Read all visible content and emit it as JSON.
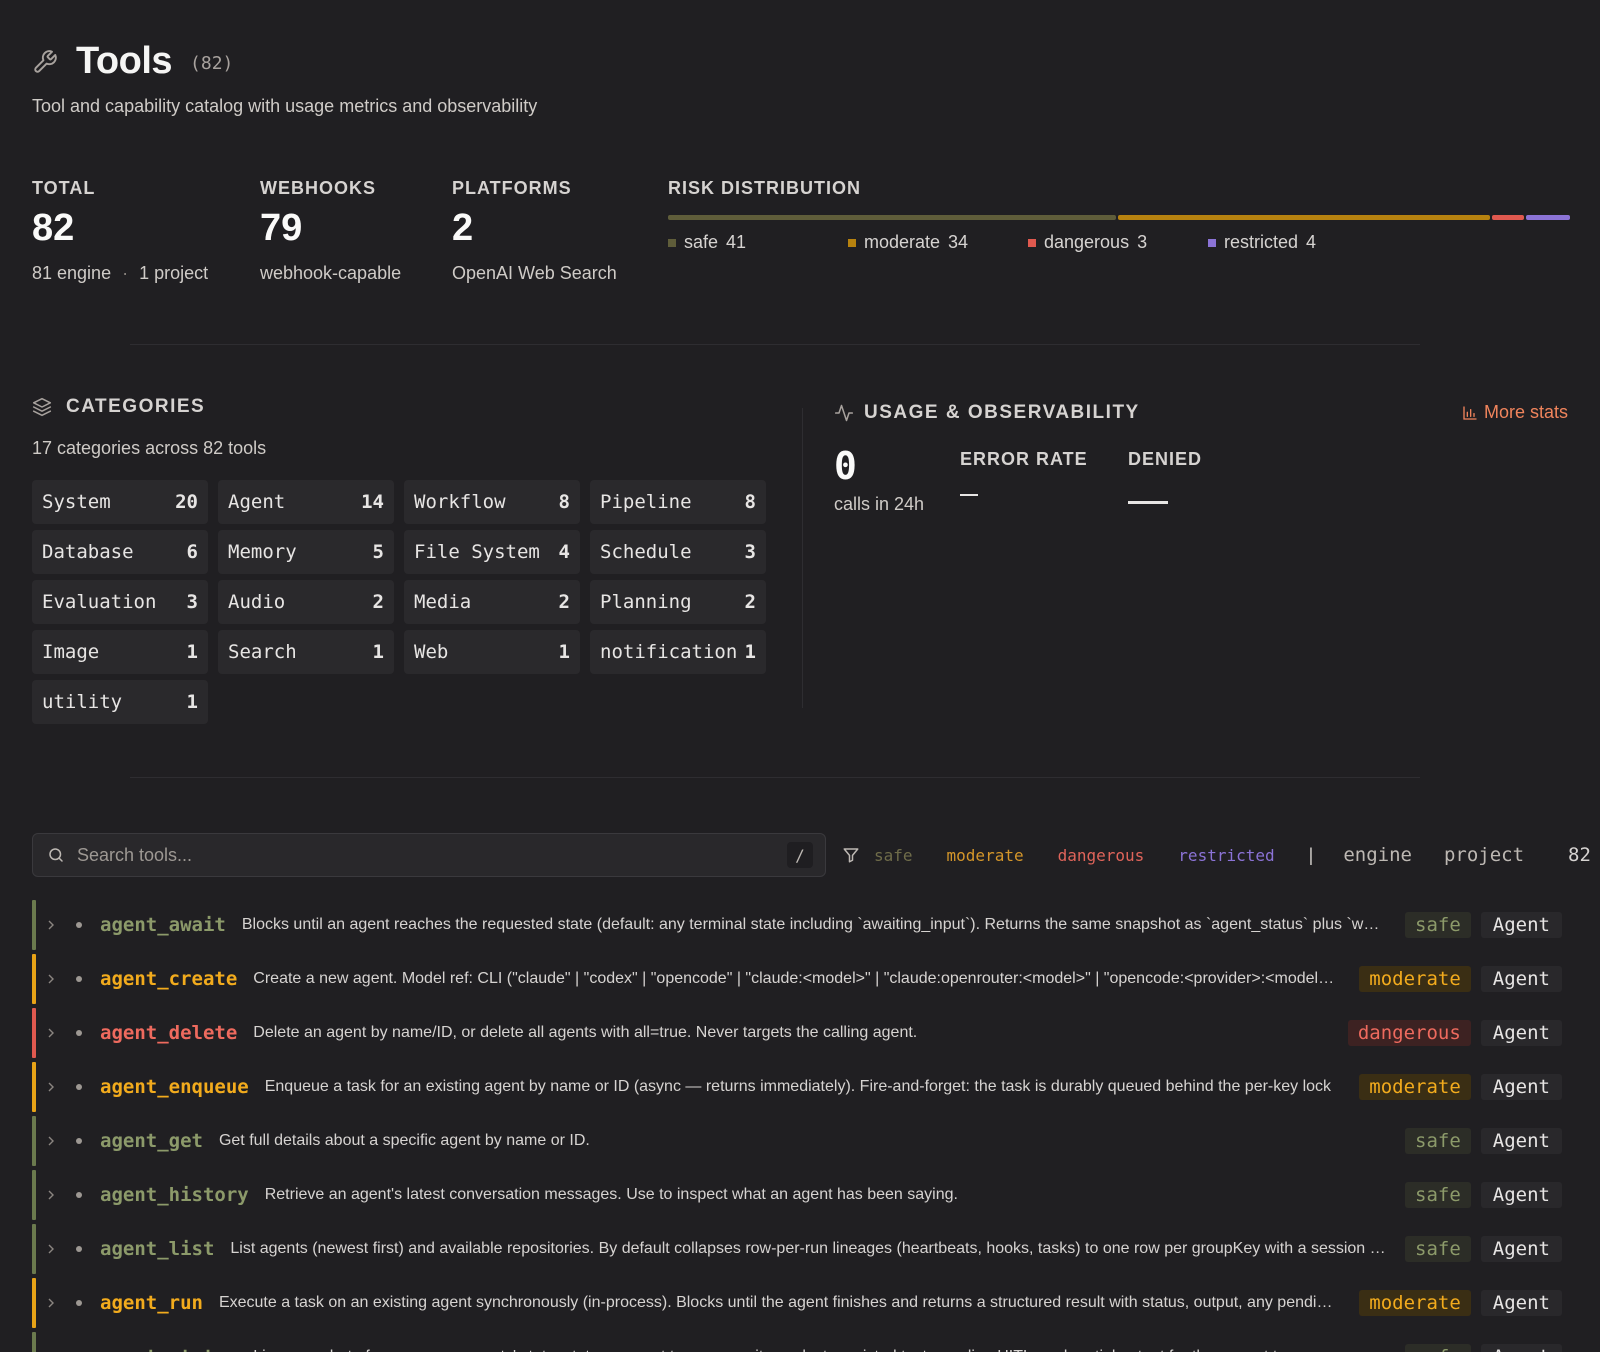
{
  "header": {
    "title": "Tools",
    "count": "(82)",
    "subtitle": "Tool and capability catalog with usage metrics and observability"
  },
  "stats": {
    "total": {
      "label": "TOTAL",
      "value": "82",
      "engine": "81 engine",
      "separator": "·",
      "project": "1 project"
    },
    "webhooks": {
      "label": "WEBHOOKS",
      "value": "79",
      "sub": "webhook-capable"
    },
    "platforms": {
      "label": "PLATFORMS",
      "value": "2",
      "sub": "OpenAI Web Search"
    },
    "risk": {
      "label": "RISK DISTRIBUTION",
      "items": [
        {
          "name": "safe",
          "count": 41,
          "color": "#5f5d3a"
        },
        {
          "name": "moderate",
          "count": 34,
          "color": "#b7820f"
        },
        {
          "name": "dangerous",
          "count": 3,
          "color": "#e0594f"
        },
        {
          "name": "restricted",
          "count": 4,
          "color": "#8b73d6"
        }
      ]
    }
  },
  "categories": {
    "title": "CATEGORIES",
    "subtitle": "17 categories across 82 tools",
    "items": [
      {
        "name": "System",
        "count": "20"
      },
      {
        "name": "Agent",
        "count": "14"
      },
      {
        "name": "Workflow",
        "count": "8"
      },
      {
        "name": "Pipeline",
        "count": "8"
      },
      {
        "name": "Database",
        "count": "6"
      },
      {
        "name": "Memory",
        "count": "5"
      },
      {
        "name": "File System",
        "count": "4"
      },
      {
        "name": "Schedule",
        "count": "3"
      },
      {
        "name": "Evaluation",
        "count": "3"
      },
      {
        "name": "Audio",
        "count": "2"
      },
      {
        "name": "Media",
        "count": "2"
      },
      {
        "name": "Planning",
        "count": "2"
      },
      {
        "name": "Image",
        "count": "1"
      },
      {
        "name": "Search",
        "count": "1"
      },
      {
        "name": "Web",
        "count": "1"
      },
      {
        "name": "notification",
        "count": "1"
      },
      {
        "name": "utility",
        "count": "1"
      }
    ]
  },
  "usage": {
    "title": "USAGE & OBSERVABILITY",
    "more_stats": "More stats",
    "calls_value": "0",
    "calls_label": "calls in 24h",
    "error_rate_label": "ERROR RATE",
    "denied_label": "DENIED"
  },
  "search": {
    "placeholder": "Search tools...",
    "shortcut": "/"
  },
  "filters": {
    "risk": [
      {
        "label": "safe",
        "color": "#6f6c4a"
      },
      {
        "label": "moderate",
        "color": "#d4962a"
      },
      {
        "label": "dangerous",
        "color": "#e0645a"
      },
      {
        "label": "restricted",
        "color": "#8b73d6"
      }
    ],
    "separator": "|",
    "engine": "engine",
    "project": "project",
    "count": "82"
  },
  "colors": {
    "safe": {
      "bar": "#6b7a4e",
      "name": "#8c9a6a",
      "badge_bg": "#2c2d27",
      "badge_fg": "#8c9a6a"
    },
    "moderate": {
      "bar": "#e8a317",
      "name": "#f2ab1d",
      "badge_bg": "#3a2e14",
      "badge_fg": "#f2ab1d"
    },
    "dangerous": {
      "bar": "#e0594f",
      "name": "#ee6a5e",
      "badge_bg": "#3d2222",
      "badge_fg": "#ee6a5e"
    }
  },
  "tools": [
    {
      "name": "agent_await",
      "desc": "Blocks until an agent reaches the requested state (default: any terminal state including `awaiting_input`). Returns the same snapshot as `agent_status` plus `waited_ms` and more detail",
      "risk": "safe",
      "category": "Agent"
    },
    {
      "name": "agent_create",
      "desc": "Create a new agent. Model ref: CLI (\"claude\" | \"codex\" | \"opencode\" | \"claude:<model>\" | \"claude:openrouter:<model>\" | \"opencode:<provider>:<model>\") and more",
      "risk": "moderate",
      "category": "Agent"
    },
    {
      "name": "agent_delete",
      "desc": "Delete an agent by name/ID, or delete all agents with all=true. Never targets the calling agent.",
      "risk": "dangerous",
      "category": "Agent"
    },
    {
      "name": "agent_enqueue",
      "desc": "Enqueue a task for an existing agent by name or ID (async — returns immediately). Fire-and-forget: the task is durably queued behind the per-key lock",
      "risk": "moderate",
      "category": "Agent"
    },
    {
      "name": "agent_get",
      "desc": "Get full details about a specific agent by name or ID.",
      "risk": "safe",
      "category": "Agent"
    },
    {
      "name": "agent_history",
      "desc": "Retrieve an agent's latest conversation messages. Use to inspect what an agent has been saying.",
      "risk": "safe",
      "category": "Agent"
    },
    {
      "name": "agent_list",
      "desc": "List agents (newest first) and available repositories. By default collapses row-per-run lineages (heartbeats, hooks, tasks) to one row per groupKey with a session count",
      "risk": "safe",
      "category": "Agent"
    },
    {
      "name": "agent_run",
      "desc": "Execute a task on an existing agent synchronously (in-process). Blocks until the agent finishes and returns a structured result with status, output, any pending input",
      "risk": "moderate",
      "category": "Agent"
    },
    {
      "name": "agent_status",
      "desc": "Live snapshot of one or more agents' state: status, current turn, queue items, last persisted text, pending HITL, and partial output for the current turn",
      "risk": "safe",
      "category": "Agent"
    }
  ]
}
